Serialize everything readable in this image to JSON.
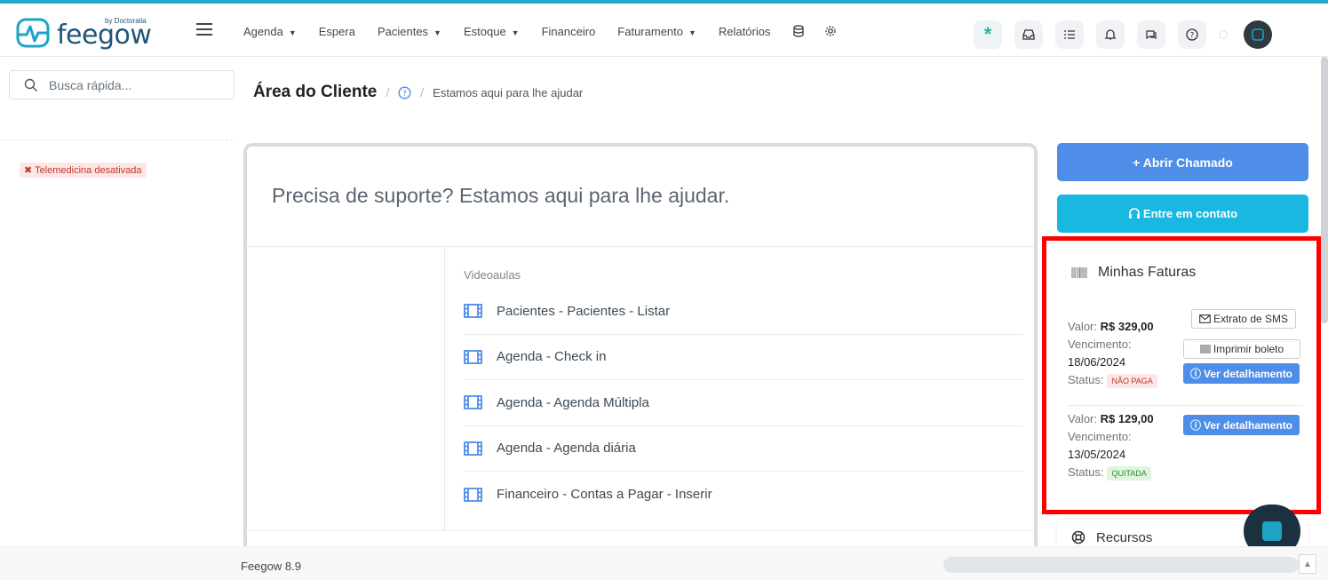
{
  "header": {
    "logo_text": "feegow",
    "logo_by": "by Doctoralia",
    "nav": [
      {
        "label": "Agenda",
        "dropdown": true
      },
      {
        "label": "Espera",
        "dropdown": false
      },
      {
        "label": "Pacientes",
        "dropdown": true
      },
      {
        "label": "Estoque",
        "dropdown": true
      },
      {
        "label": "Financeiro",
        "dropdown": false
      },
      {
        "label": "Faturamento",
        "dropdown": true
      },
      {
        "label": "Relatórios",
        "dropdown": false
      }
    ],
    "icons": [
      "asterisk-icon",
      "inbox-icon",
      "checklist-icon",
      "bell-icon",
      "chat-icon",
      "help-icon",
      "avatar"
    ]
  },
  "sidebar": {
    "search_placeholder": "Busca rápida...",
    "telemedicina_badge": "Telemedicina desativada"
  },
  "breadcrumb": {
    "title": "Área do Cliente",
    "subtitle": "Estamos aqui para lhe ajudar"
  },
  "main": {
    "heading": "Precisa de suporte? Estamos aqui para lhe ajudar.",
    "videos_title": "Videoaulas",
    "videos": [
      "Pacientes - Pacientes - Listar",
      "Agenda - Check in",
      "Agenda - Agenda Múltipla",
      "Agenda - Agenda diária",
      "Financeiro - Contas a Pagar - Inserir"
    ]
  },
  "actions": {
    "abrir_chamado": "+ Abrir Chamado",
    "entre_contato": "Entre em contato"
  },
  "faturas": {
    "title": "Minhas Faturas",
    "valor_label": "Valor:",
    "vencimento_label": "Vencimento:",
    "status_label": "Status:",
    "invoices": [
      {
        "valor": "R$ 329,00",
        "vencimento": "18/06/2024",
        "status": "NÃO PAGA"
      },
      {
        "valor": "R$ 129,00",
        "vencimento": "13/05/2024",
        "status": "QUITADA"
      }
    ],
    "btn_extrato": "Extrato de SMS",
    "btn_boleto": "Imprimir boleto",
    "btn_detalhamento": "Ver detalhamento"
  },
  "recursos": {
    "title": "Recursos"
  },
  "footer": {
    "version": "Feegow 8.9"
  },
  "colors": {
    "accent": "#4f8ee8",
    "cyan": "#18b8e0",
    "highlight": "#ff0000"
  }
}
